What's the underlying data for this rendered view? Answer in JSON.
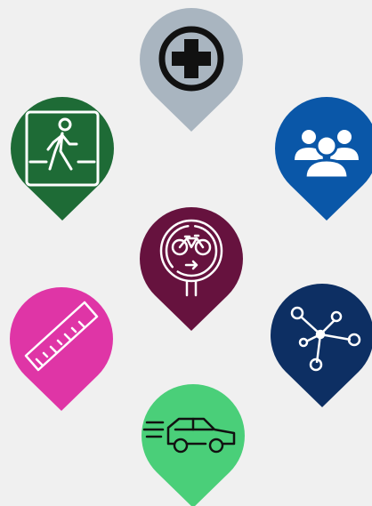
{
  "pins": [
    {
      "id": "medical",
      "icon": "medical-cross-icon",
      "color": "#a9b5c0"
    },
    {
      "id": "pedestrian",
      "icon": "pedestrian-crossing-icon",
      "color": "#1e6b36"
    },
    {
      "id": "community",
      "icon": "people-group-icon",
      "color": "#0a57a8"
    },
    {
      "id": "bike-route",
      "icon": "bicycle-sign-icon",
      "color": "#66123e"
    },
    {
      "id": "measure",
      "icon": "ruler-icon",
      "color": "#df35a6"
    },
    {
      "id": "network",
      "icon": "network-nodes-icon",
      "color": "#0d2f63"
    },
    {
      "id": "traffic",
      "icon": "fast-car-icon",
      "color": "#4acf79"
    }
  ]
}
